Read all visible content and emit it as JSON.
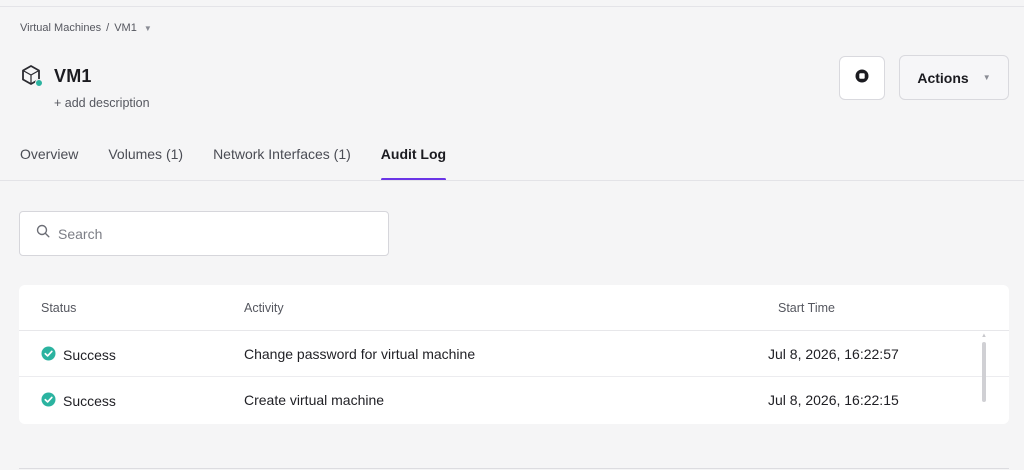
{
  "breadcrumb": {
    "parent": "Virtual Machines",
    "separator": "/",
    "current": "VM1"
  },
  "vm": {
    "name": "VM1",
    "add_description": "+ add description",
    "status_color": "#2bb3a0"
  },
  "header_actions": {
    "stop_icon": "stop-icon",
    "actions_label": "Actions"
  },
  "tabs": [
    {
      "label": "Overview",
      "active": false
    },
    {
      "label": "Volumes (1)",
      "active": false
    },
    {
      "label": "Network Interfaces (1)",
      "active": false
    },
    {
      "label": "Audit Log",
      "active": true
    }
  ],
  "search": {
    "placeholder": "Search",
    "value": ""
  },
  "audit_table": {
    "columns": [
      "Status",
      "Activity",
      "Start Time"
    ],
    "rows": [
      {
        "status": "Success",
        "activity": "Change password for virtual machine",
        "start_time": "Jul 8, 2026, 16:22:57"
      },
      {
        "status": "Success",
        "activity": "Create virtual machine",
        "start_time": "Jul 8, 2026, 16:22:15"
      }
    ]
  },
  "colors": {
    "accent": "#6a35e6",
    "success": "#2bb3a0"
  }
}
